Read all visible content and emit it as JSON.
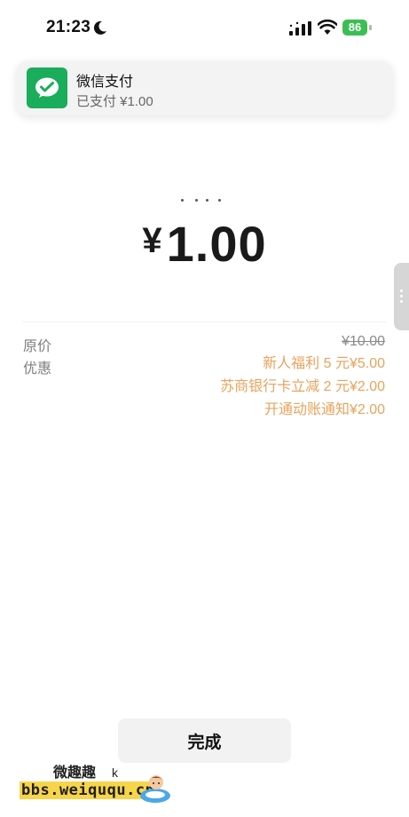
{
  "status_bar": {
    "time": "21:23",
    "battery": "86"
  },
  "notification": {
    "app_name": "微信支付",
    "message": "已支付 ¥1.00"
  },
  "payment": {
    "currency": "¥",
    "amount": "1.00"
  },
  "details": {
    "original_label": "原价",
    "original_price": "¥10.00",
    "discount_label": "优惠",
    "discounts": [
      "新人福利 5 元¥5.00",
      "苏商银行卡立减 2 元¥2.00",
      "开通动账通知¥2.00"
    ]
  },
  "done_button": "完成",
  "watermark": {
    "title": "微趣趣",
    "letter": "k",
    "url": "bbs.weiququ.cn"
  },
  "colors": {
    "wechat_green": "#1aad5b",
    "discount_orange": "#e8a35c",
    "battery_green": "#3dbe55"
  },
  "icons": [
    "moon-icon",
    "signal-icon",
    "wifi-icon",
    "battery-icon",
    "wechat-pay-icon"
  ]
}
